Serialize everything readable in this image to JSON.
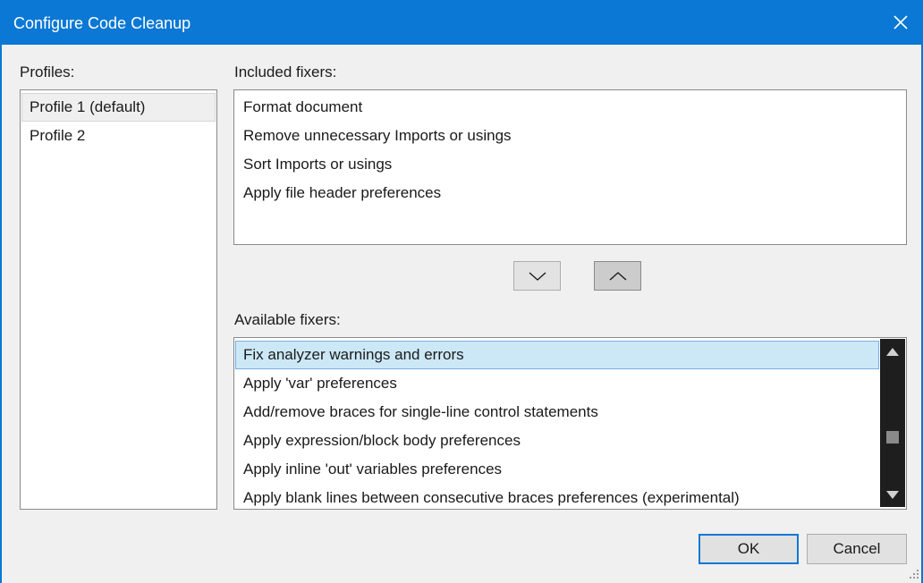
{
  "window": {
    "title": "Configure Code Cleanup"
  },
  "colors": {
    "accent": "#0a78d4",
    "selection": "#cce8f6",
    "scrollbar": "#1e1e1e"
  },
  "icons": {
    "close": "close-icon",
    "down": "chevron-down-icon",
    "up": "chevron-up-icon"
  },
  "profiles": {
    "label": "Profiles:",
    "items": [
      "Profile 1 (default)",
      "Profile 2"
    ],
    "selected": 0
  },
  "included": {
    "label": "Included fixers:",
    "items": [
      "Format document",
      "Remove unnecessary Imports or usings",
      "Sort Imports or usings",
      "Apply file header preferences"
    ]
  },
  "available": {
    "label": "Available fixers:",
    "items": [
      "Fix analyzer warnings and errors",
      "Apply 'var' preferences",
      "Add/remove braces for single-line control statements",
      "Apply expression/block body preferences",
      "Apply inline 'out' variables preferences",
      "Apply blank lines between consecutive braces preferences (experimental)"
    ],
    "selected": 0
  },
  "buttons": {
    "ok": "OK",
    "cancel": "Cancel"
  }
}
